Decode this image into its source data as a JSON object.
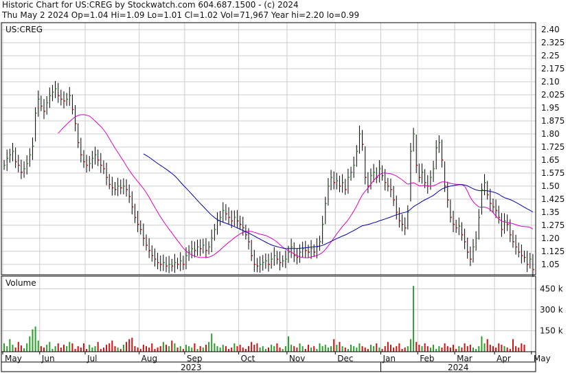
{
  "header": {
    "line1": "Historic Chart for US:CREG by Stockwatch.com 604.687.1500 - (c) 2024",
    "line2": "Thu May  2 2024   Op=1.04  Hi=1.09  Lo=1.01  Cl=1.02  Vol=71,967  Year hi=2.20  lo=0.99"
  },
  "colors": {
    "up": "#2a9d2a",
    "down": "#cc1111",
    "ma_short": "#e000c0",
    "ma_long": "#0000aa",
    "grid": "#cccccc",
    "frame": "#000000"
  },
  "chart_data": [
    {
      "type": "ohlc",
      "title": "US:CREG",
      "y_ticks": [
        "2.40",
        "2.325",
        "2.25",
        "2.175",
        "2.10",
        "2.025",
        "1.95",
        "1.875",
        "1.80",
        "1.725",
        "1.65",
        "1.575",
        "1.50",
        "1.425",
        "1.35",
        "1.275",
        "1.20",
        "1.125",
        "1.05"
      ],
      "ylim": [
        0.99,
        2.44
      ],
      "x_ticks": [
        "May",
        "Jun",
        "Jul",
        "Aug",
        "Sep",
        "Oct",
        "Nov",
        "Dec",
        "Jan",
        "Feb",
        "Mar",
        "Apr",
        "May"
      ],
      "year_labels": [
        "2023",
        "2024"
      ],
      "grid": true,
      "close": [
        1.62,
        1.66,
        1.68,
        1.7,
        1.64,
        1.62,
        1.58,
        1.6,
        1.63,
        1.68,
        1.73,
        1.92,
        2.0,
        1.96,
        1.93,
        1.98,
        2.02,
        2.04,
        2.06,
        2.02,
        2.0,
        1.99,
        2.0,
        2.02,
        1.94,
        1.86,
        1.75,
        1.68,
        1.64,
        1.62,
        1.63,
        1.66,
        1.68,
        1.65,
        1.62,
        1.6,
        1.55,
        1.51,
        1.49,
        1.48,
        1.5,
        1.49,
        1.5,
        1.48,
        1.44,
        1.38,
        1.32,
        1.28,
        1.25,
        1.2,
        1.16,
        1.13,
        1.1,
        1.08,
        1.06,
        1.05,
        1.06,
        1.04,
        1.05,
        1.04,
        1.06,
        1.05,
        1.07,
        1.05,
        1.1,
        1.12,
        1.14,
        1.13,
        1.15,
        1.14,
        1.16,
        1.13,
        1.15,
        1.2,
        1.25,
        1.3,
        1.32,
        1.36,
        1.34,
        1.32,
        1.3,
        1.32,
        1.3,
        1.28,
        1.26,
        1.22,
        1.18,
        1.1,
        1.05,
        1.04,
        1.05,
        1.06,
        1.07,
        1.05,
        1.08,
        1.1,
        1.08,
        1.06,
        1.07,
        1.08,
        1.12,
        1.15,
        1.1,
        1.09,
        1.12,
        1.14,
        1.13,
        1.12,
        1.14,
        1.12,
        1.15,
        1.18,
        1.28,
        1.4,
        1.5,
        1.55,
        1.52,
        1.53,
        1.5,
        1.52,
        1.48,
        1.55,
        1.58,
        1.62,
        1.7,
        1.8,
        1.74,
        1.55,
        1.5,
        1.56,
        1.58,
        1.55,
        1.6,
        1.56,
        1.52,
        1.5,
        1.48,
        1.42,
        1.35,
        1.3,
        1.28,
        1.26,
        1.35,
        1.7,
        1.8,
        1.62,
        1.55,
        1.58,
        1.52,
        1.5,
        1.55,
        1.6,
        1.72,
        1.75,
        1.65,
        1.5,
        1.42,
        1.32,
        1.28,
        1.26,
        1.27,
        1.22,
        1.18,
        1.12,
        1.08,
        1.15,
        1.2,
        1.32,
        1.48,
        1.52,
        1.45,
        1.4,
        1.38,
        1.36,
        1.32,
        1.25,
        1.3,
        1.28,
        1.22,
        1.18,
        1.15,
        1.12,
        1.1,
        1.09,
        1.05,
        1.08,
        1.02
      ],
      "series": [
        {
          "name": "",
          "points": []
        },
        {
          "name": "",
          "points": []
        }
      ]
    },
    {
      "type": "bar",
      "title": "Volume",
      "y_ticks": [
        "450 k",
        "300 k",
        "150 k"
      ],
      "ylim": [
        0,
        540000
      ],
      "values": [
        60000,
        40000,
        90000,
        50000,
        30000,
        70000,
        45000,
        25000,
        60000,
        110000,
        160000,
        180000,
        80000,
        40000,
        30000,
        50000,
        70000,
        20000,
        40000,
        60000,
        30000,
        50000,
        40000,
        70000,
        60000,
        20000,
        40000,
        30000,
        60000,
        20000,
        50000,
        30000,
        40000,
        70000,
        20000,
        30000,
        50000,
        60000,
        80000,
        40000,
        30000,
        20000,
        50000,
        70000,
        90000,
        100000,
        40000,
        30000,
        20000,
        50000,
        40000,
        30000,
        60000,
        20000,
        30000,
        40000,
        70000,
        50000,
        40000,
        80000,
        60000,
        30000,
        40000,
        20000,
        50000,
        40000,
        30000,
        60000,
        20000,
        40000,
        30000,
        50000,
        70000,
        130000,
        60000,
        40000,
        30000,
        50000,
        40000,
        20000,
        30000,
        60000,
        40000,
        50000,
        30000,
        20000,
        40000,
        70000,
        50000,
        60000,
        30000,
        40000,
        20000,
        30000,
        50000,
        40000,
        60000,
        30000,
        20000,
        40000,
        110000,
        50000,
        40000,
        30000,
        60000,
        40000,
        20000,
        50000,
        30000,
        40000,
        20000,
        60000,
        40000,
        50000,
        30000,
        40000,
        90000,
        50000,
        70000,
        40000,
        30000,
        20000,
        50000,
        40000,
        30000,
        60000,
        40000,
        30000,
        20000,
        50000,
        40000,
        60000,
        30000,
        20000,
        40000,
        70000,
        50000,
        30000,
        40000,
        60000,
        20000,
        30000,
        40000,
        90000,
        470000,
        70000,
        50000,
        40000,
        60000,
        40000,
        30000,
        50000,
        20000,
        40000,
        30000,
        60000,
        40000,
        30000,
        50000,
        20000,
        40000,
        30000,
        60000,
        40000,
        50000,
        30000,
        20000,
        40000,
        110000,
        60000,
        90000,
        50000,
        40000,
        30000,
        60000,
        50000,
        40000,
        30000,
        20000,
        90000,
        40000,
        30000,
        60000,
        50000
      ]
    }
  ]
}
